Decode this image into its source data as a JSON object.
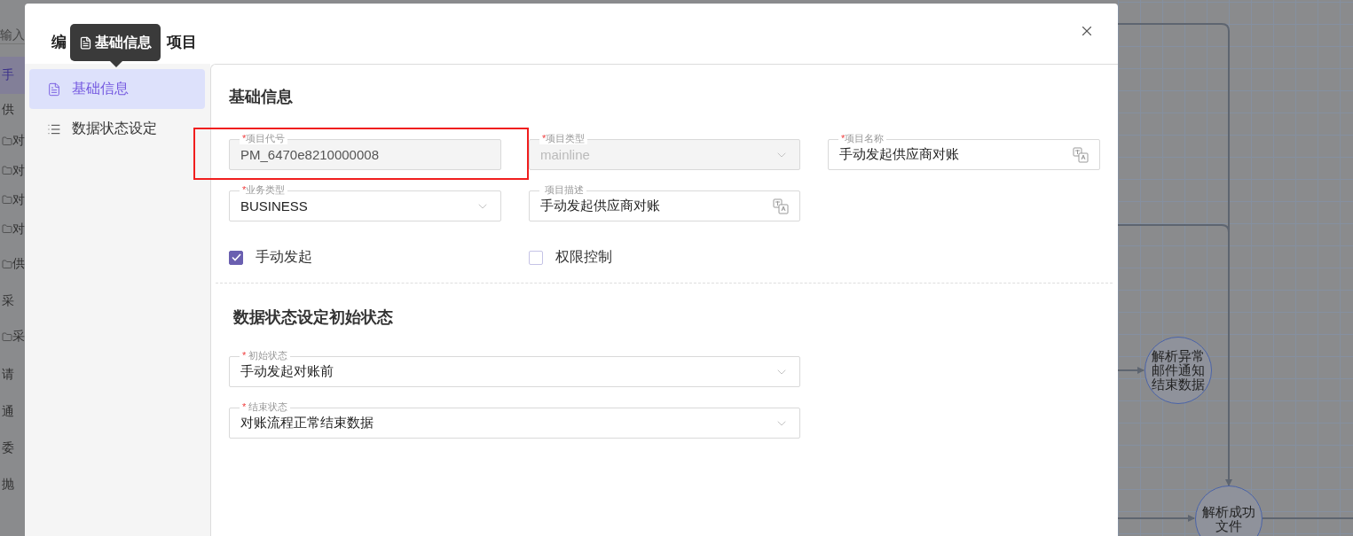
{
  "background_sidebar": {
    "search_placeholder": "输入",
    "items": [
      {
        "kind": "text",
        "label": "手",
        "selected": true
      },
      {
        "kind": "text",
        "label": "供",
        "selected": false
      },
      {
        "kind": "folder",
        "label": "对",
        "selected": false
      },
      {
        "kind": "folder",
        "label": "对",
        "selected": false
      },
      {
        "kind": "folder",
        "label": "对",
        "selected": false
      },
      {
        "kind": "folder",
        "label": "对",
        "selected": false
      },
      {
        "kind": "folder",
        "label": "供",
        "selected": false
      },
      {
        "kind": "text",
        "label": "采",
        "selected": false
      },
      {
        "kind": "folder",
        "label": "采",
        "selected": false
      },
      {
        "kind": "text",
        "label": "请",
        "selected": false
      },
      {
        "kind": "text",
        "label": "通",
        "selected": false
      },
      {
        "kind": "text",
        "label": "委",
        "selected": false
      },
      {
        "kind": "text",
        "label": "抛",
        "selected": false
      }
    ]
  },
  "flow_nodes": [
    {
      "label": "解析异常邮件通知结束数据"
    },
    {
      "label": "解析成功文件"
    }
  ],
  "dialog": {
    "title_start": "编",
    "title_end": "项目",
    "tooltip": "基础信息",
    "nav": [
      {
        "label": "基础信息",
        "selected": true
      },
      {
        "label": "数据状态设定",
        "selected": false
      }
    ],
    "sections": [
      {
        "title": "基础信息",
        "fields": [
          {
            "kind": "text",
            "mark": "*",
            "label": "项目代号",
            "value": "PM_6470e8210000008",
            "disabled": true,
            "highlighted": true
          },
          {
            "kind": "select",
            "mark": "*",
            "label": "项目类型",
            "value": "mainline",
            "disabled": true
          },
          {
            "kind": "text",
            "mark": "*",
            "label": "项目名称",
            "value": "手动发起供应商对账",
            "disabled": false,
            "translate": true
          },
          {
            "kind": "select",
            "mark": "*",
            "label": "业务类型",
            "value": "BUSINESS",
            "disabled": false
          },
          {
            "kind": "text",
            "label": "项目描述",
            "value": "手动发起供应商对账",
            "disabled": false,
            "translate": true
          }
        ],
        "checkboxes": [
          {
            "label": "手动发起",
            "checked": true
          },
          {
            "label": "权限控制",
            "checked": false
          }
        ]
      },
      {
        "title": "数据状态设定初始状态",
        "fields": [
          {
            "kind": "select",
            "mark": "* ",
            "label": "初始状态",
            "value": "手动发起对账前",
            "disabled": false
          },
          {
            "kind": "select",
            "mark": "* ",
            "label": "结束状态",
            "value": "对账流程正常结束数据",
            "disabled": false
          }
        ]
      }
    ]
  }
}
